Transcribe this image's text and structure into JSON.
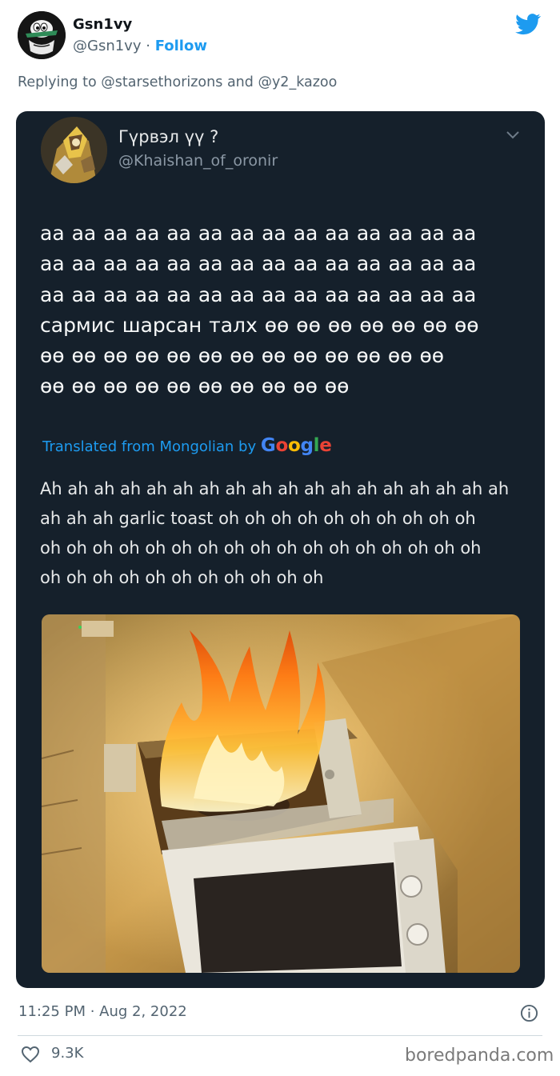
{
  "tweet": {
    "display_name": "Gsn1vy",
    "handle": "@Gsn1vy",
    "separator": "·",
    "follow_label": "Follow",
    "replying_prefix": "Replying to",
    "replying_mention_1": "@starsethorizons",
    "replying_and": "and",
    "replying_mention_2": "@y2_kazoo",
    "timestamp": "11:25 PM · Aug 2, 2022",
    "likes": "9.3K",
    "watermark": "boredpanda.com"
  },
  "quoted": {
    "name": "Гүрвэл үү ?",
    "handle": "@Khaishan_of_oronir",
    "text_lines": [
      "аа аа аа аа аа аа аа аа аа аа аа аа аа аа",
      "аа аа аа аа аа аа аа аа аа аа аа аа аа аа",
      "аа аа аа аа аа аа аа аа аа аа аа аа аа аа",
      "сармис шарсан талх өө өө өө өө өө өө өө",
      "өө өө өө өө өө өө өө өө өө өө өө өө өө",
      "өө өө өө өө өө өө өө өө өө өө"
    ],
    "translated_prefix": "Translated from Mongolian by",
    "google_g1": "G",
    "google_o1": "o",
    "google_o2": "o",
    "google_g2": "g",
    "google_l": "l",
    "google_e": "e",
    "translation_lines": [
      "Ah ah ah ah ah ah ah ah ah ah ah ah ah ah ah ah ah ah",
      "ah ah ah garlic toast oh oh oh oh oh oh oh oh oh oh",
      "oh oh oh oh oh oh oh oh oh oh oh oh oh oh oh oh oh",
      "oh oh oh oh oh oh oh oh oh oh oh"
    ]
  },
  "colors": {
    "card_bg": "#15202b",
    "accent": "#1d9bf0",
    "muted": "#536471"
  },
  "icons": {
    "brand": "twitter-bird-icon",
    "more": "chevron-down-icon",
    "info": "info-icon",
    "like": "heart-icon"
  }
}
